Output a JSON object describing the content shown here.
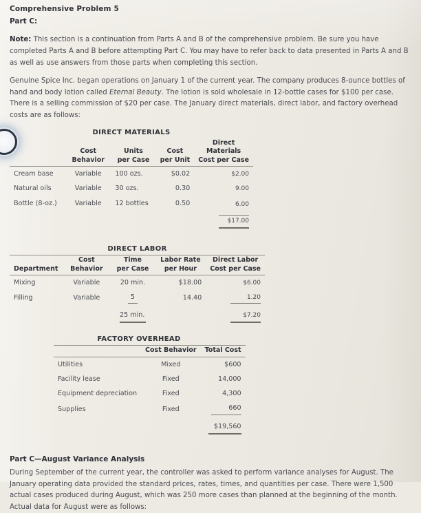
{
  "document": {
    "title": "Comprehensive Problem 5",
    "part": "Part C:"
  },
  "note": {
    "label": "Note:",
    "text": " This section is a continuation from Parts A and B of the comprehensive problem. Be sure you have completed Parts A and B before attempting Part C. You may have to refer back to data presented in Parts A and B as well as use answers from those parts when completing this section."
  },
  "intro": {
    "text_before_italic": "Genuine Spice Inc. began operations on January 1 of the current year. The company produces 8-ounce bottles of hand and body lotion called ",
    "italic_product": "Eternal Beauty",
    "text_after_italic": ". The lotion is sold wholesale in 12-bottle cases for $100 per case. There is a selling commission of $20 per case. The January direct materials, direct labor, and factory overhead costs are as follows:"
  },
  "direct_materials": {
    "caption": "DIRECT MATERIALS",
    "headers": {
      "item": "",
      "cost_behavior_l1": "Cost",
      "cost_behavior_l2": "Behavior",
      "units_l1": "Units",
      "units_l2": "per Case",
      "cost_unit_l1": "Cost",
      "cost_unit_l2": "per Unit",
      "dm_cost_l1": "Direct",
      "dm_cost_l2": "Materials",
      "dm_cost_l3": "Cost per Case"
    },
    "rows": [
      {
        "item": "Cream base",
        "cost_behavior": "Variable",
        "units_per_case": "100 ozs.",
        "cost_per_unit": "$0.02",
        "dm_cost_per_case": "$2.00"
      },
      {
        "item": "Natural oils",
        "cost_behavior": "Variable",
        "units_per_case": "30 ozs.",
        "cost_per_unit": "0.30",
        "dm_cost_per_case": "9.00"
      },
      {
        "item": "Bottle (8-oz.)",
        "cost_behavior": "Variable",
        "units_per_case": "12 bottles",
        "cost_per_unit": "0.50",
        "dm_cost_per_case": "6.00"
      }
    ],
    "total": "$17.00"
  },
  "direct_labor": {
    "caption": "DIRECT LABOR",
    "headers": {
      "department": "Department",
      "cost_behavior_l1": "Cost",
      "cost_behavior_l2": "Behavior",
      "time_l1": "Time",
      "time_l2": "per Case",
      "rate_l1": "Labor Rate",
      "rate_l2": "per Hour",
      "dl_cost_l1": "Direct Labor",
      "dl_cost_l2": "Cost per Case"
    },
    "rows": [
      {
        "department": "Mixing",
        "cost_behavior": "Variable",
        "time_per_case": "20 min.",
        "labor_rate_per_hour": "$18.00",
        "dl_cost_per_case": "$6.00"
      },
      {
        "department": "Filling",
        "cost_behavior": "Variable",
        "time_per_case": "5",
        "labor_rate_per_hour": "14.40",
        "dl_cost_per_case": "1.20"
      }
    ],
    "total_time": "25 min.",
    "total_cost": "$7.20"
  },
  "factory_overhead": {
    "caption": "FACTORY OVERHEAD",
    "headers": {
      "item": "",
      "cost_behavior": "Cost Behavior",
      "total_cost": "Total Cost"
    },
    "rows": [
      {
        "item": "Utilities",
        "cost_behavior": "Mixed",
        "total_cost": "$600"
      },
      {
        "item": "Facility lease",
        "cost_behavior": "Fixed",
        "total_cost": "14,000"
      },
      {
        "item": "Equipment depreciation",
        "cost_behavior": "Fixed",
        "total_cost": "4,300"
      },
      {
        "item": "Supplies",
        "cost_behavior": "Fixed",
        "total_cost": "660"
      }
    ],
    "total": "$19,560"
  },
  "part_c": {
    "heading": "Part C—August Variance Analysis",
    "body": "During September of the current year, the controller was asked to perform variance analyses for August. The January operating data provided the standard prices, rates, times, and quantities per case. There were 1,500 actual cases produced during August, which was 250 more cases than planned at the beginning of the month. Actual data for August were as follows:"
  },
  "artifacts": {
    "cursor_ring": "touch-cursor-ring"
  },
  "colors": {
    "page_background": "#eeebe4",
    "body_text": "#4a4b52",
    "heading_text": "#2f3138",
    "rule": "#8f8c85"
  }
}
